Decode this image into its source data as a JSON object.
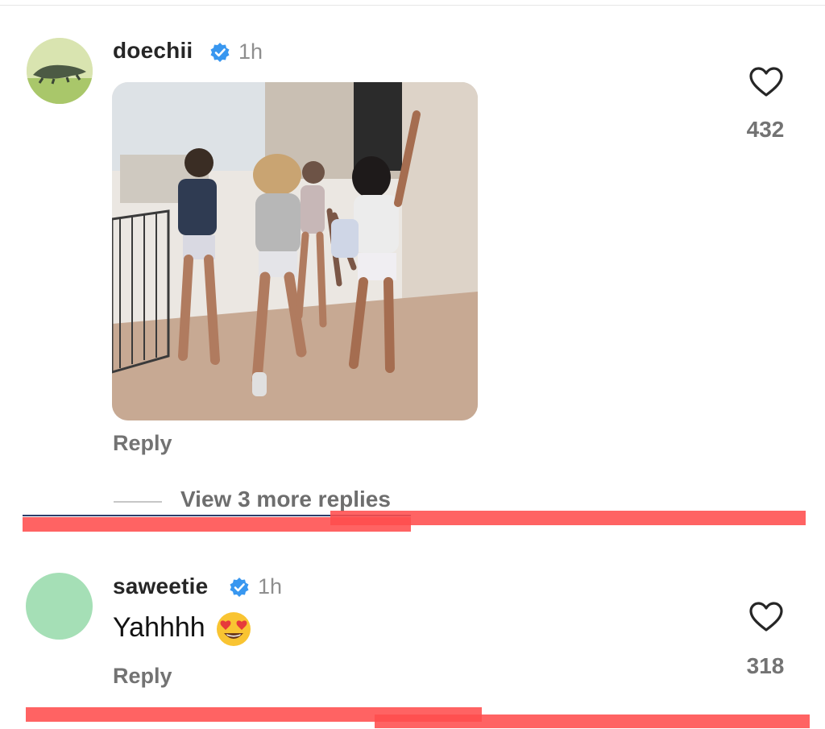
{
  "comments": [
    {
      "username": "doechii",
      "time": "1h",
      "verified": true,
      "media": "dancing-gif",
      "reply_label": "Reply",
      "likes": "432",
      "view_more": "View 3 more replies"
    },
    {
      "username": "saweetie",
      "time": "1h",
      "verified": true,
      "text": "Yahhhh",
      "emoji": "heart-eyes-emoji",
      "reply_label": "Reply",
      "likes": "318"
    }
  ],
  "colors": {
    "verified_blue": "#3897f0",
    "secondary_text": "#737373",
    "annotation_red": "#ff4d4d",
    "avatar_green": "#a5dfb6"
  }
}
